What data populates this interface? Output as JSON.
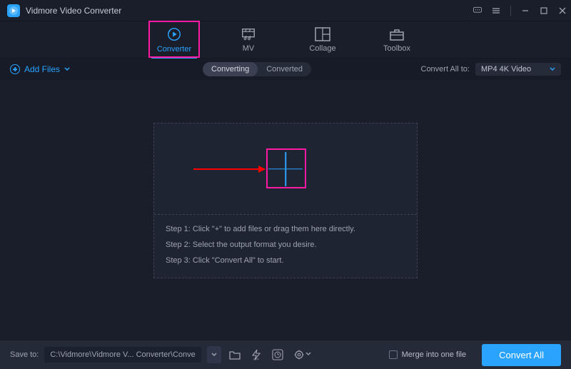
{
  "app": {
    "title": "Vidmore Video Converter"
  },
  "tabs": {
    "converter": "Converter",
    "mv": "MV",
    "collage": "Collage",
    "toolbox": "Toolbox"
  },
  "toolbar": {
    "add_files": "Add Files",
    "converting": "Converting",
    "converted": "Converted",
    "convert_all_to": "Convert All to:",
    "format_value": "MP4 4K Video"
  },
  "dropzone": {
    "step1": "Step 1: Click \"+\" to add files or drag them here directly.",
    "step2": "Step 2: Select the output format you desire.",
    "step3": "Step 3: Click \"Convert All\" to start."
  },
  "footer": {
    "save_to_label": "Save to:",
    "path": "C:\\Vidmore\\Vidmore V... Converter\\Converted",
    "merge_label": "Merge into one file",
    "convert_all": "Convert All"
  }
}
